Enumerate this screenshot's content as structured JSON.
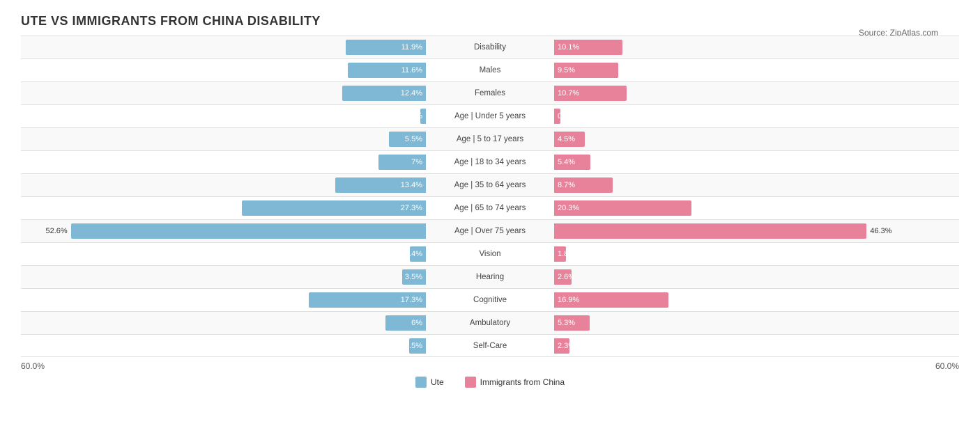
{
  "title": "UTE VS IMMIGRANTS FROM CHINA DISABILITY",
  "source": "Source: ZipAtlas.com",
  "axis": {
    "left": "60.0%",
    "right": "60.0%"
  },
  "legend": {
    "item1": "Ute",
    "item2": "Immigrants from China"
  },
  "rows": [
    {
      "label": "Disability",
      "ute": 11.9,
      "china": 10.1
    },
    {
      "label": "Males",
      "ute": 11.6,
      "china": 9.5
    },
    {
      "label": "Females",
      "ute": 12.4,
      "china": 10.7
    },
    {
      "label": "Age | Under 5 years",
      "ute": 0.86,
      "china": 0.96
    },
    {
      "label": "Age | 5 to 17 years",
      "ute": 5.5,
      "china": 4.5
    },
    {
      "label": "Age | 18 to 34 years",
      "ute": 7.0,
      "china": 5.4
    },
    {
      "label": "Age | 35 to 64 years",
      "ute": 13.4,
      "china": 8.7
    },
    {
      "label": "Age | 65 to 74 years",
      "ute": 27.3,
      "china": 20.3
    },
    {
      "label": "Age | Over 75 years",
      "ute": 52.6,
      "china": 46.3
    },
    {
      "label": "Vision",
      "ute": 2.4,
      "china": 1.8
    },
    {
      "label": "Hearing",
      "ute": 3.5,
      "china": 2.6
    },
    {
      "label": "Cognitive",
      "ute": 17.3,
      "china": 16.9
    },
    {
      "label": "Ambulatory",
      "ute": 6.0,
      "china": 5.3
    },
    {
      "label": "Self-Care",
      "ute": 2.5,
      "china": 2.3
    }
  ]
}
